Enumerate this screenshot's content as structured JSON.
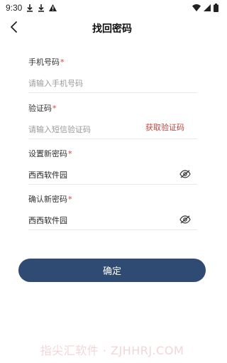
{
  "status_bar": {
    "time": "9:30",
    "icons": [
      "download-icon",
      "download-icon",
      "warning-icon",
      "wifi-icon",
      "signal-icon",
      "battery-icon"
    ]
  },
  "header": {
    "title": "找回密码",
    "back_icon": "chevron-left-icon"
  },
  "form": {
    "phone": {
      "label": "手机号码",
      "required": "*",
      "placeholder": "请输入手机号码",
      "value": ""
    },
    "code": {
      "label": "验证码",
      "required": "*",
      "placeholder": "请输入短信验证码",
      "value": "",
      "get_code_label": "获取验证码"
    },
    "new_password": {
      "label": "设置新密码",
      "required": "*",
      "placeholder": "",
      "value": "西西软件园",
      "toggle_icon": "eye-slash-icon"
    },
    "confirm_password": {
      "label": "确认新密码",
      "required": "*",
      "placeholder": "",
      "value": "西西软件园",
      "toggle_icon": "eye-slash-icon"
    }
  },
  "actions": {
    "confirm_label": "确定"
  },
  "watermark": "指尖汇软件 · ZJHHRJ.COM",
  "colors": {
    "primary": "#2f4a73",
    "accent_red": "#c2473f",
    "required_red": "#d0453c",
    "divider": "#e8e8e8"
  }
}
